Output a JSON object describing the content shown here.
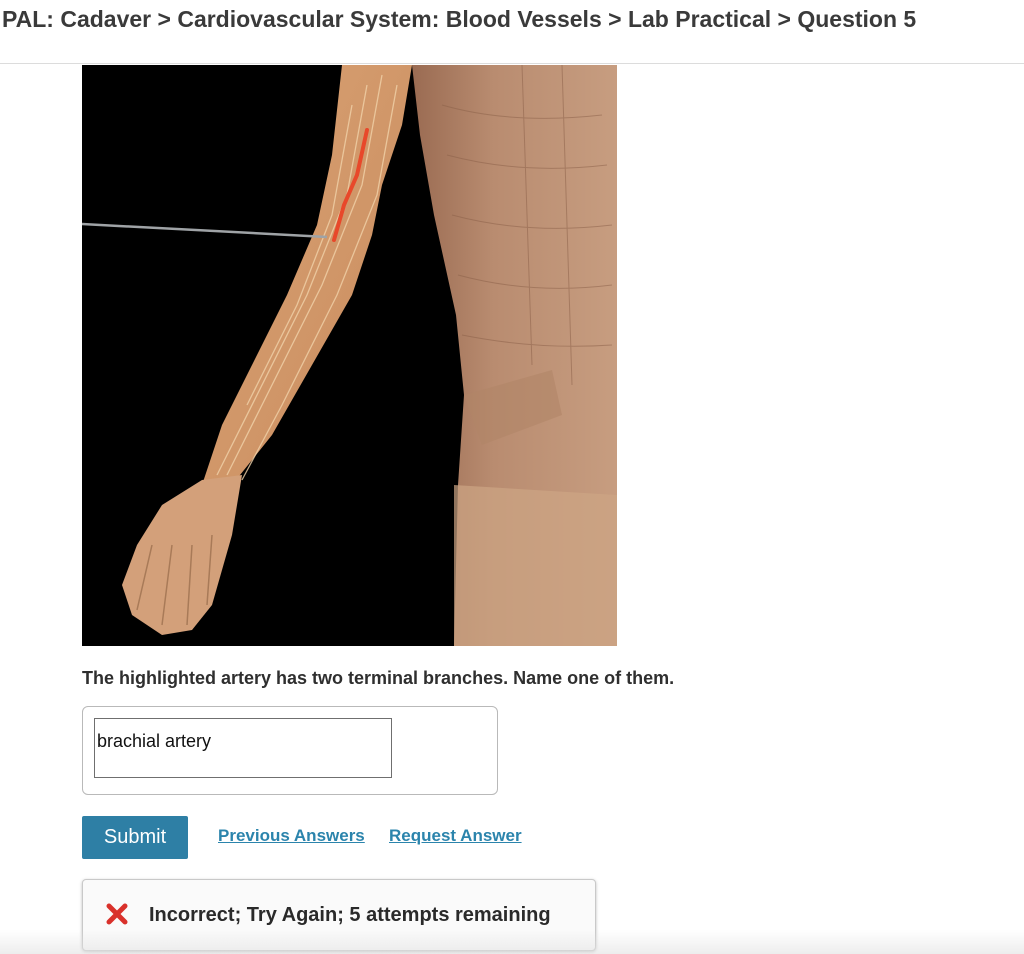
{
  "header": {
    "breadcrumb": "PAL: Cadaver > Cardiovascular System: Blood Vessels > Lab Practical > Question 5"
  },
  "question": {
    "prompt": "The highlighted artery has two terminal branches. Name one of them.",
    "answer_value": "brachial artery"
  },
  "actions": {
    "submit_label": "Submit",
    "previous_answers_label": "Previous Answers",
    "request_answer_label": "Request Answer"
  },
  "feedback": {
    "message": "Incorrect; Try Again; 5 attempts remaining",
    "icon": "x-mark-icon",
    "status_color": "#d9312b"
  },
  "colors": {
    "accent": "#2e7fa5",
    "link": "#2b84ac",
    "artery_highlight": "#e8482a"
  }
}
